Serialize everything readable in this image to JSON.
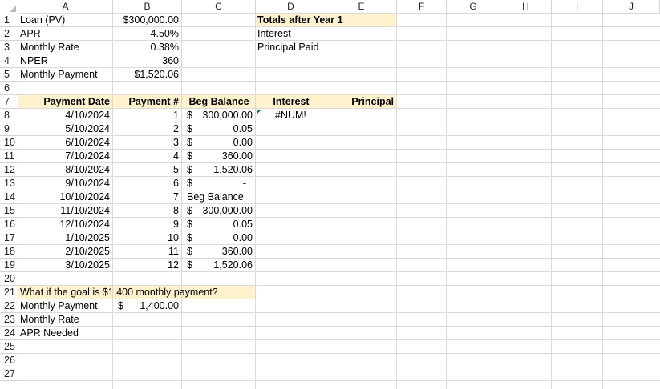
{
  "columns": [
    "A",
    "B",
    "C",
    "D",
    "E",
    "F",
    "G",
    "H",
    "I",
    "J"
  ],
  "rows": [
    1,
    2,
    3,
    4,
    5,
    6,
    7,
    8,
    9,
    10,
    11,
    12,
    13,
    14,
    15,
    16,
    17,
    18,
    19,
    20,
    21,
    22,
    23,
    24,
    25,
    26,
    27
  ],
  "inputs": {
    "loan_label": "Loan (PV)",
    "loan_value": "$300,000.00",
    "apr_label": "APR",
    "apr_value": "4.50%",
    "rate_label": "Monthly Rate",
    "rate_value": "0.38%",
    "nper_label": "NPER",
    "nper_value": "360",
    "pmt_label": "Monthly Payment",
    "pmt_value": "$1,520.06"
  },
  "totals": {
    "title": "Totals after Year 1",
    "interest_label": "Interest",
    "principal_label": "Principal Paid"
  },
  "table": {
    "headers": [
      "Payment Date",
      "Payment #",
      "Beg Balance",
      "Interest",
      "Principal"
    ],
    "rows": [
      {
        "date": "4/10/2024",
        "num": "1",
        "dollar": "$",
        "bal": "300,000.00",
        "interest": "#NUM!"
      },
      {
        "date": "5/10/2024",
        "num": "2",
        "dollar": "$",
        "bal": "0.05"
      },
      {
        "date": "6/10/2024",
        "num": "3",
        "dollar": "$",
        "bal": "0.00"
      },
      {
        "date": "7/10/2024",
        "num": "4",
        "dollar": "$",
        "bal": "360.00"
      },
      {
        "date": "8/10/2024",
        "num": "5",
        "dollar": "$",
        "bal": "1,520.06"
      },
      {
        "date": "9/10/2024",
        "num": "6",
        "dollar": "$",
        "bal": "-"
      },
      {
        "date": "10/10/2024",
        "num": "7",
        "text": "Beg Balance"
      },
      {
        "date": "11/10/2024",
        "num": "8",
        "dollar": "$",
        "bal": "300,000.00"
      },
      {
        "date": "12/10/2024",
        "num": "9",
        "dollar": "$",
        "bal": "0.05"
      },
      {
        "date": "1/10/2025",
        "num": "10",
        "dollar": "$",
        "bal": "0.00"
      },
      {
        "date": "2/10/2025",
        "num": "11",
        "dollar": "$",
        "bal": "360.00"
      },
      {
        "date": "3/10/2025",
        "num": "12",
        "dollar": "$",
        "bal": "1,520.06"
      }
    ]
  },
  "goal": {
    "question": "What if the goal is $1,400 monthly payment?",
    "pmt_label": "Monthly Payment",
    "pmt_dollar": "$",
    "pmt_value": "1,400.00",
    "rate_label": "Monthly Rate",
    "apr_label": "APR Needed"
  },
  "colors": {
    "highlight": "#fff2cc",
    "gridline": "#dadada",
    "error_indicator": "#1e7b34"
  }
}
